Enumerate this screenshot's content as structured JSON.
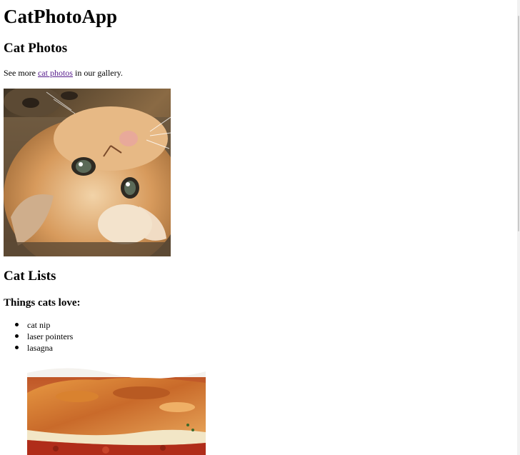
{
  "header": {
    "title": "CatPhotoApp"
  },
  "photos_section": {
    "heading": "Cat Photos",
    "text_before_link": "See more ",
    "link_text": "cat photos",
    "text_after_link": " in our gallery.",
    "image_name": "kitten-lying-on-back"
  },
  "lists_section": {
    "heading": "Cat Lists",
    "subheading": "Things cats love:",
    "items": [
      {
        "label": "cat nip"
      },
      {
        "label": "laser pointers"
      },
      {
        "label": "lasagna"
      }
    ],
    "image_name": "lasagna-dish"
  },
  "colors": {
    "text": "#000000",
    "link_visited": "#551a8b",
    "background": "#ffffff"
  }
}
